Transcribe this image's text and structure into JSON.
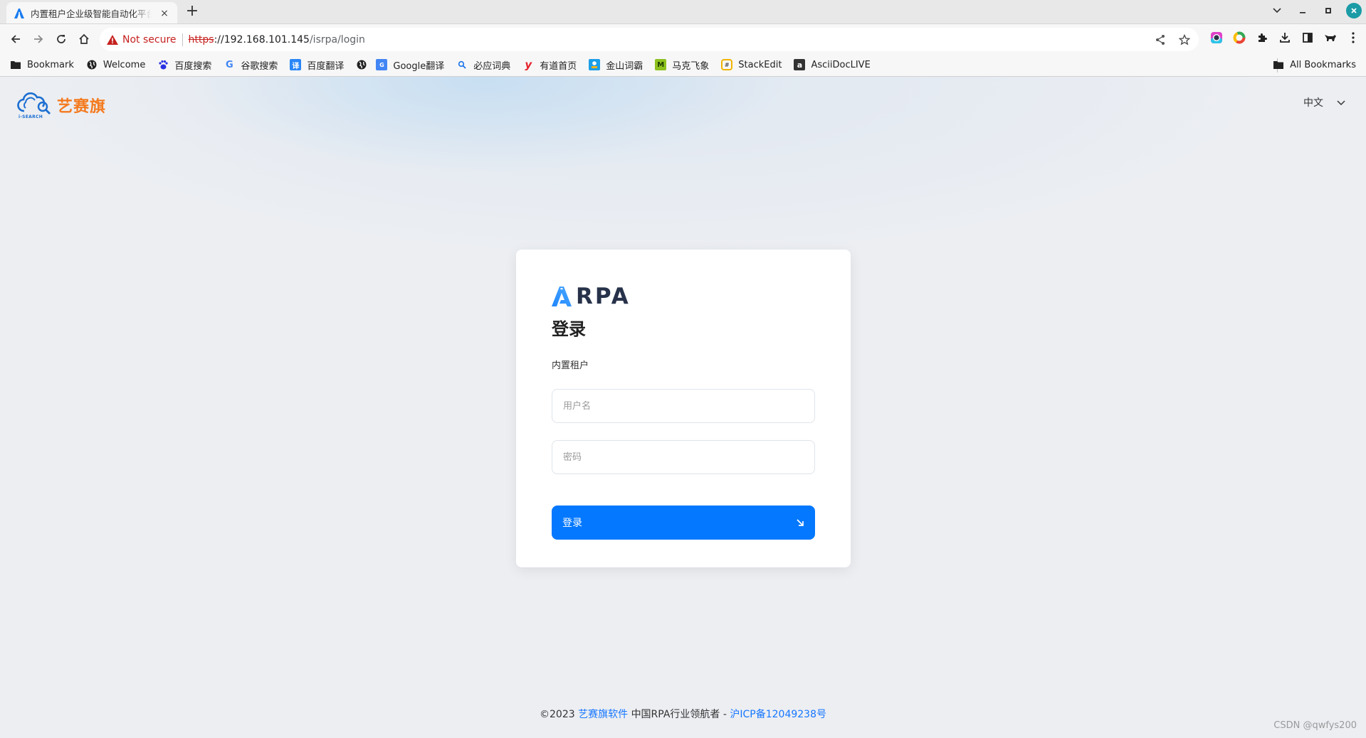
{
  "browser": {
    "tab": {
      "title": "内置租户企业级智能自动化平台",
      "close_label": "×"
    },
    "new_tab_label": "+",
    "window_controls": {
      "tab_search": "⌄",
      "minimize": "–",
      "maximize": "▫",
      "close": "✕"
    },
    "omnibox": {
      "security_label": "Not secure",
      "url_scheme": "https",
      "url_host": "://192.168.101.145",
      "url_path": "/isrpa/login"
    },
    "bookmarks": [
      {
        "label": "Bookmark",
        "icon": "folder-icon"
      },
      {
        "label": "Welcome",
        "icon": "globe-icon"
      },
      {
        "label": "百度搜索",
        "icon": "baidu-paw-icon"
      },
      {
        "label": "谷歌搜索",
        "icon": "google-icon"
      },
      {
        "label": "百度翻译",
        "icon": "baidu-translate-icon"
      },
      {
        "label": "",
        "icon": "globe-icon"
      },
      {
        "label": "Google翻译",
        "icon": "google-translate-icon"
      },
      {
        "label": "必应词典",
        "icon": "bing-search-icon"
      },
      {
        "label": "有道首页",
        "icon": "youdao-icon"
      },
      {
        "label": "金山词霸",
        "icon": "iciba-icon"
      },
      {
        "label": "马克飞象",
        "icon": "maxiang-icon"
      },
      {
        "label": "StackEdit",
        "icon": "stackedit-icon"
      },
      {
        "label": "AsciiDocLIVE",
        "icon": "asciidoc-icon"
      }
    ],
    "all_bookmarks_label": "All Bookmarks"
  },
  "page": {
    "brand": {
      "name": "艺赛旗",
      "sub": "i-SEARCH"
    },
    "language": "中文",
    "login": {
      "logo_text": "RPA",
      "title": "登录",
      "tenant": "内置租户",
      "username_placeholder": "用户名",
      "password_placeholder": "密码",
      "submit_label": "登录"
    },
    "footer": {
      "copyright": "©2023",
      "company_link": "艺赛旗软件",
      "slogan": "中国RPA行业领航者 -",
      "icp_link": "沪ICP备12049238号"
    },
    "watermark": "CSDN @qwfys200"
  },
  "colors": {
    "primary": "#0478ff",
    "brand_orange": "#f47a1f",
    "link": "#1677ff",
    "insecure_red": "#c5221f"
  }
}
